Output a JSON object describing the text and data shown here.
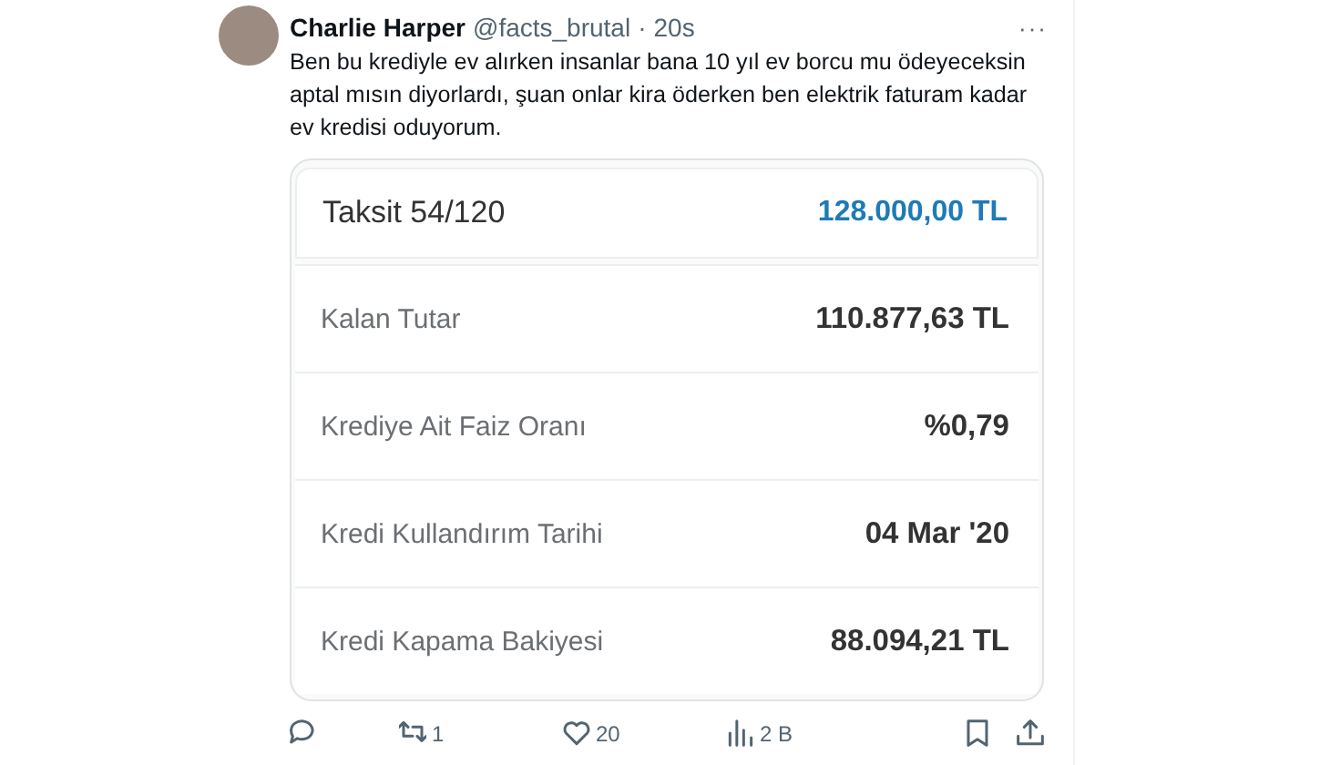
{
  "tweet": {
    "author": "Charlie Harper",
    "handle": "@facts_brutal",
    "separator": "·",
    "time": "20s",
    "more": "···",
    "text": "Ben bu krediyle ev alırken insanlar bana 10 yıl ev borcu mu ödeyeceksin aptal mısın diyorlardı, şuan onlar kira öderken ben elektrik faturam kadar ev kredisi oduyorum."
  },
  "loan_rows": [
    {
      "kind": "header",
      "label": "Taksit 54/120",
      "value": "128.000,00 TL"
    },
    {
      "kind": "detail",
      "label": "Kalan Tutar",
      "value": "110.877,63 TL"
    },
    {
      "kind": "detail",
      "label": "Krediye Ait Faiz Oranı",
      "value": "%0,79"
    },
    {
      "kind": "detail",
      "label": "Kredi Kullandırım Tarihi",
      "value": "04 Mar '20"
    },
    {
      "kind": "detail",
      "label": "Kredi Kapama Bakiyesi",
      "value": "88.094,21 TL"
    }
  ],
  "actions": [
    {
      "kind": "reply"
    },
    {
      "kind": "retweet",
      "count": "1"
    },
    {
      "kind": "like",
      "count": "20"
    },
    {
      "kind": "views",
      "count": "2 B"
    },
    {
      "kind": "bookmark"
    },
    {
      "kind": "share"
    }
  ]
}
